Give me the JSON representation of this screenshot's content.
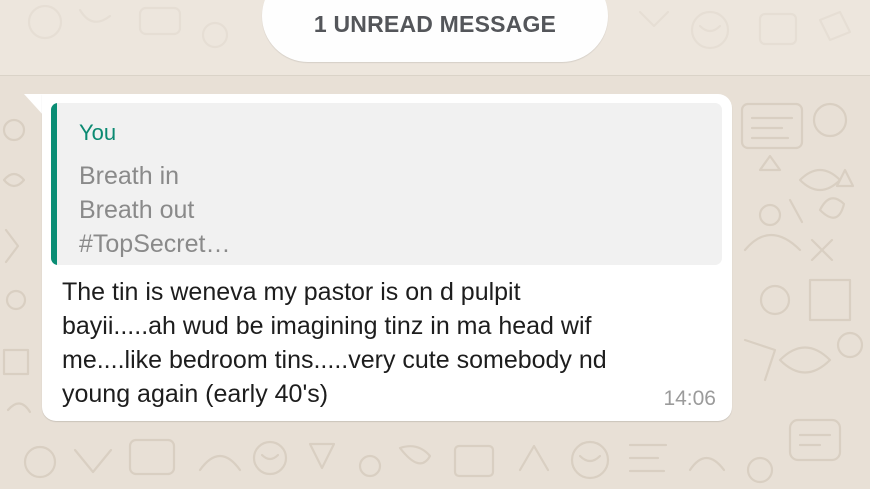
{
  "chat": {
    "unread_banner": "1 UNREAD MESSAGE",
    "message": {
      "quoted": {
        "author": "You",
        "lines": [
          "Breath in",
          "Breath out",
          "#TopSecret…"
        ]
      },
      "body_lines": [
        "The tin is weneva my pastor is on d pulpit",
        "bayii.....ah wud be imagining tinz in ma head wif",
        "me....like bedroom tins.....very cute somebody nd",
        "young again (early 40's)"
      ],
      "time": "14:06"
    }
  },
  "colors": {
    "wallpaper": "#e8e0d6",
    "bubble": "#ffffff",
    "quote_accent": "#0a8d74",
    "quote_author": "#0b8a72"
  }
}
